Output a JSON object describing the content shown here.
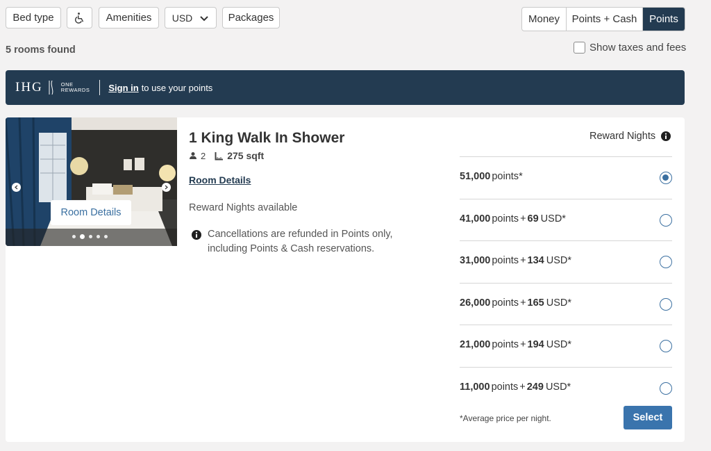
{
  "filters": {
    "bed_type": "Bed type",
    "amenities": "Amenities",
    "currency": "USD",
    "packages": "Packages"
  },
  "payment_toggle": {
    "money": "Money",
    "points_cash": "Points + Cash",
    "points": "Points",
    "selected": "Points"
  },
  "rooms_found": "5 rooms found",
  "show_taxes": "Show taxes and fees",
  "banner": {
    "brand": "IHG",
    "program_line1": "ONE",
    "program_line2": "REWARDS",
    "sign_in": "Sign in",
    "sign_in_suffix": "to use your points"
  },
  "room": {
    "title": "1 King Walk In Shower",
    "guests": "2",
    "size": "275 sqft",
    "details_link": "Room Details",
    "photo_overlay": "Room Details",
    "availability": "Reward Nights available",
    "cancellation": "Cancellations are refunded in Points only, including Points & Cash reservations."
  },
  "rates": {
    "header": "Reward Nights",
    "points_word": "points",
    "options": [
      {
        "points": "51,000",
        "cash": "",
        "suffix": "*",
        "selected": true
      },
      {
        "points": "41,000",
        "cash": "69",
        "suffix": "USD*",
        "selected": false
      },
      {
        "points": "31,000",
        "cash": "134",
        "suffix": "USD*",
        "selected": false
      },
      {
        "points": "26,000",
        "cash": "165",
        "suffix": "USD*",
        "selected": false
      },
      {
        "points": "21,000",
        "cash": "194",
        "suffix": "USD*",
        "selected": false
      },
      {
        "points": "11,000",
        "cash": "249",
        "suffix": "USD*",
        "selected": false
      }
    ],
    "note": "*Average price per night.",
    "select_label": "Select"
  },
  "colors": {
    "navy": "#233b51",
    "accent_blue": "#3a74ad"
  }
}
